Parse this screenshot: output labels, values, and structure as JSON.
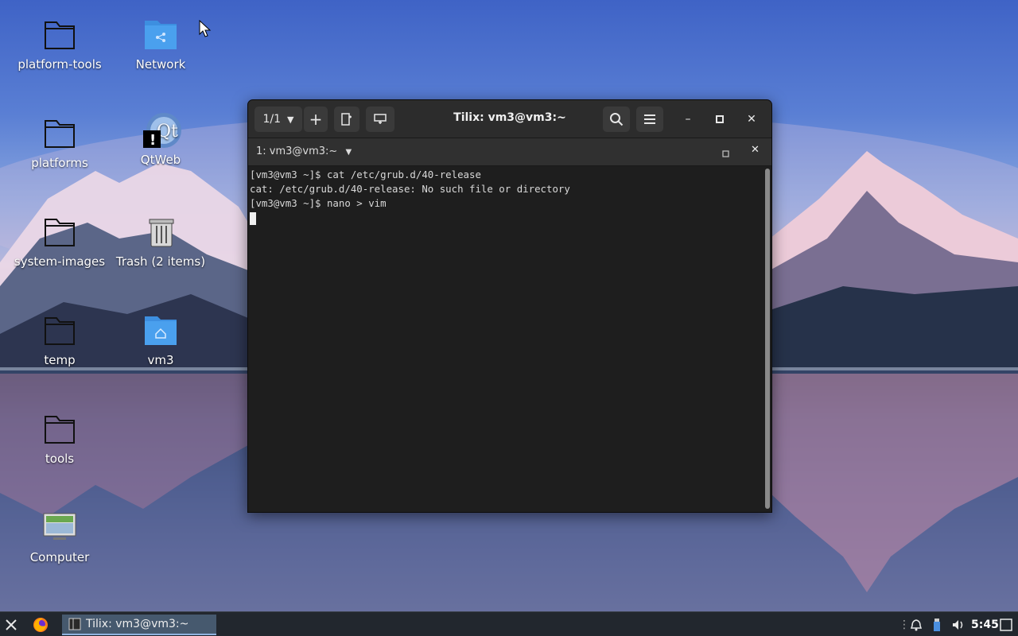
{
  "desktop": {
    "icons": [
      {
        "label": "platform-tools",
        "icon": "folder-icon"
      },
      {
        "label": "Network",
        "icon": "network-folder-icon"
      },
      {
        "label": "platforms",
        "icon": "folder-icon"
      },
      {
        "label": "QtWeb",
        "icon": "qtweb-app-icon"
      },
      {
        "label": "system-images",
        "icon": "folder-icon"
      },
      {
        "label": "Trash (2 items)",
        "icon": "trash-icon"
      },
      {
        "label": "temp",
        "icon": "folder-icon"
      },
      {
        "label": "vm3",
        "icon": "home-folder-icon"
      },
      {
        "label": "tools",
        "icon": "folder-icon"
      },
      {
        "label": "Computer",
        "icon": "computer-icon"
      }
    ]
  },
  "window": {
    "title": "Tilix: vm3@vm3:~",
    "session_counter": "1/1",
    "session_title": "1: vm3@vm3:~",
    "terminal_lines": [
      "[vm3@vm3 ~]$ cat /etc/grub.d/40-release",
      "cat: /etc/grub.d/40-release: No such file or directory",
      "[vm3@vm3 ~]$ nano > vim"
    ]
  },
  "taskbar": {
    "task_label": "Tilix: vm3@vm3:~",
    "clock": "5:45"
  },
  "colors": {
    "window_bg": "#1e1e1e",
    "titlebar_bg": "#2c2c2c",
    "taskbar_bg": "#22272e",
    "task_active": "#46596e"
  }
}
